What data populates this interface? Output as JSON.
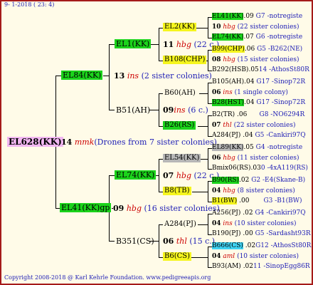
{
  "header": "9-  1-2018 ( 23:  4)",
  "footer": "Copyright 2008-2018 @ Karl Kehrle Foundation.   www.pedigreeapis.org",
  "root": {
    "name": "EL628(KK)"
  },
  "g1": [
    {
      "name": "EL84(KK)",
      "num": "13",
      "sp": "ins",
      "note": "(2 sister colonies)"
    },
    {
      "name": "EL41(KK)gp",
      "num": "09",
      "sp": "hbg",
      "note": "(16 sister colonies)"
    }
  ],
  "root_mid": {
    "num": "14",
    "sp": "mmk",
    "note": "(Drones from 7 sister colonies)"
  },
  "g2": [
    {
      "name": "EL1(KK)",
      "num": "11",
      "sp": "hbg",
      "note": "(22 c.)"
    },
    {
      "name": "B51(AH)",
      "num": "09",
      "sp": "ins",
      "note": "(6 c.)"
    },
    {
      "name": "EL74(KK)",
      "num": "07",
      "sp": "hbg",
      "note": "(22 c.)"
    },
    {
      "name": "B351(CS)",
      "num": "06",
      "sp": "thl",
      "note": "(15 c.)"
    }
  ],
  "g3": [
    {
      "name": "EL2(KK)"
    },
    {
      "name": "B108(CHP)"
    },
    {
      "name": "B60(AH)"
    },
    {
      "name": "B26(RS)"
    },
    {
      "name": "EL54(KK)"
    },
    {
      "name": "B8(TB)"
    },
    {
      "name": "A284(PJ)"
    },
    {
      "name": "B6(CS)"
    }
  ],
  "g4": [
    {
      "name": "EL41(KK)",
      "v": ".09",
      "s": "G7 -notregiste"
    },
    {
      "num": "10",
      "sp": "hbg",
      "note": "(22 sister colonies)"
    },
    {
      "name": "EL74(KK)",
      "v": ".07",
      "s": "G6 -notregiste"
    },
    {
      "name": "B99(CHP)",
      "v": ".06",
      "s": "G5 -B262(NE)"
    },
    {
      "num": "08",
      "sp": "hbg",
      "note": "(15 sister colonies)"
    },
    {
      "name": "B292(HSB)",
      "v": ".05",
      "s": "14 -AthosSt80R"
    },
    {
      "name": "B105(AH)",
      "v": ".04",
      "s": "G17 -Sinop72R"
    },
    {
      "num": "06",
      "sp": "ins",
      "note": "(1 single colony)"
    },
    {
      "name": "B28(HST)",
      "v": ".04",
      "s": "G17 -Sinop72R"
    },
    {
      "name": "B2(TR)",
      "v": ".06",
      "s": "G8 -NO6294R"
    },
    {
      "num": "07",
      "sp": "thl",
      "note": "(22 sister colonies)"
    },
    {
      "name": "A284(PJ)",
      "v": ".04",
      "s": "G5 -Cankiri97Q"
    },
    {
      "name": "EL89(KK)",
      "v": ".05",
      "s": "G4 -notregiste"
    },
    {
      "num": "06",
      "sp": "hbg",
      "note": "(11 sister colonies)"
    },
    {
      "name": "Bmix06(RS)",
      "v": ".03",
      "s": "0 -4xA119(RS)"
    },
    {
      "name": "B90(RS)",
      "v": ".02",
      "s": "G2 -E4(Skane-B)"
    },
    {
      "num": "04",
      "sp": "hbg",
      "note": "(8 sister colonies)"
    },
    {
      "name": "B1(BW)",
      "v": ".00",
      "s": "G3 -B1(BW)"
    },
    {
      "name": "A256(PJ)",
      "v": ".02",
      "s": "G4 -Cankiri97Q"
    },
    {
      "num": "04",
      "sp": "ins",
      "note": "(10 sister colonies)"
    },
    {
      "name": "B190(PJ)",
      "v": ".00",
      "s": "G5 -Sardasht93R"
    },
    {
      "name": "B666(CS)",
      "v": ".02",
      "s": "G12 -AthosSt80R"
    },
    {
      "num": "04",
      "sp": "aml",
      "note": "(10 sister colonies)"
    },
    {
      "name": "B93(AM)",
      "v": ".02",
      "s": "11 -SinopEgg86R"
    }
  ]
}
